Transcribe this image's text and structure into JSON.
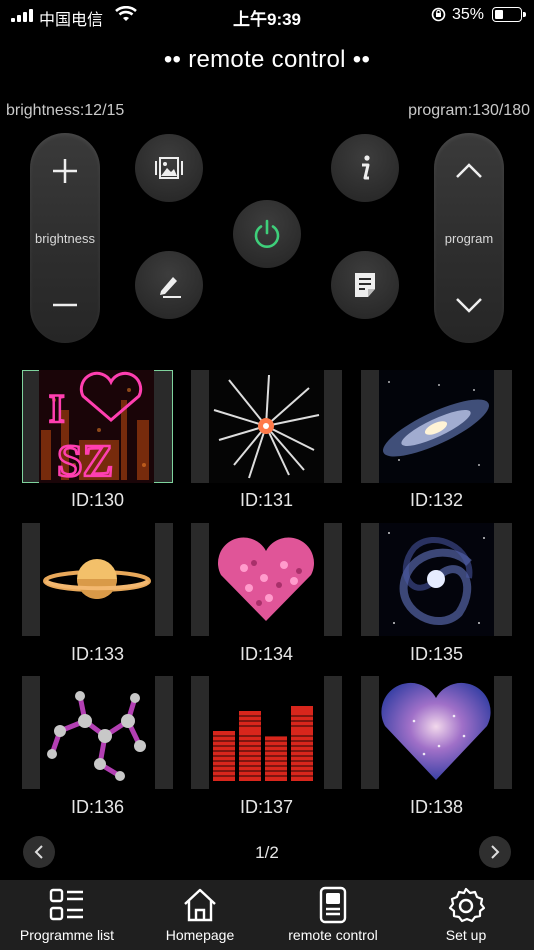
{
  "status_bar": {
    "carrier": "中国电信",
    "time": "上午9:39",
    "battery_percent": "35%",
    "battery_level": 0.35
  },
  "header": {
    "title": "•• remote control ••"
  },
  "info": {
    "brightness": "brightness:12/15",
    "program": "program:130/180"
  },
  "remote": {
    "brightness_label": "brightness",
    "program_label": "program"
  },
  "thumbnails": [
    {
      "label": "ID:130",
      "image": "i-love-sz",
      "selected": true
    },
    {
      "label": "ID:131",
      "image": "starburst",
      "selected": false
    },
    {
      "label": "ID:132",
      "image": "galaxy",
      "selected": false
    },
    {
      "label": "ID:133",
      "image": "saturn",
      "selected": false
    },
    {
      "label": "ID:134",
      "image": "pink-heart",
      "selected": false
    },
    {
      "label": "ID:135",
      "image": "spiral-galaxy",
      "selected": false
    },
    {
      "label": "ID:136",
      "image": "molecule",
      "selected": false
    },
    {
      "label": "ID:137",
      "image": "equalizer",
      "selected": false
    },
    {
      "label": "ID:138",
      "image": "nebula-heart",
      "selected": false
    }
  ],
  "pager": {
    "text": "1/2"
  },
  "tabbar": {
    "items": [
      {
        "label": "Programme list",
        "icon": "list-icon"
      },
      {
        "label": "Homepage",
        "icon": "home-icon"
      },
      {
        "label": "remote control",
        "icon": "remote-icon"
      },
      {
        "label": "Set up",
        "icon": "gear-icon"
      }
    ]
  },
  "colors": {
    "background": "#000000",
    "power_accent": "#3ecf7a",
    "selected_border": "#7fd39d"
  }
}
